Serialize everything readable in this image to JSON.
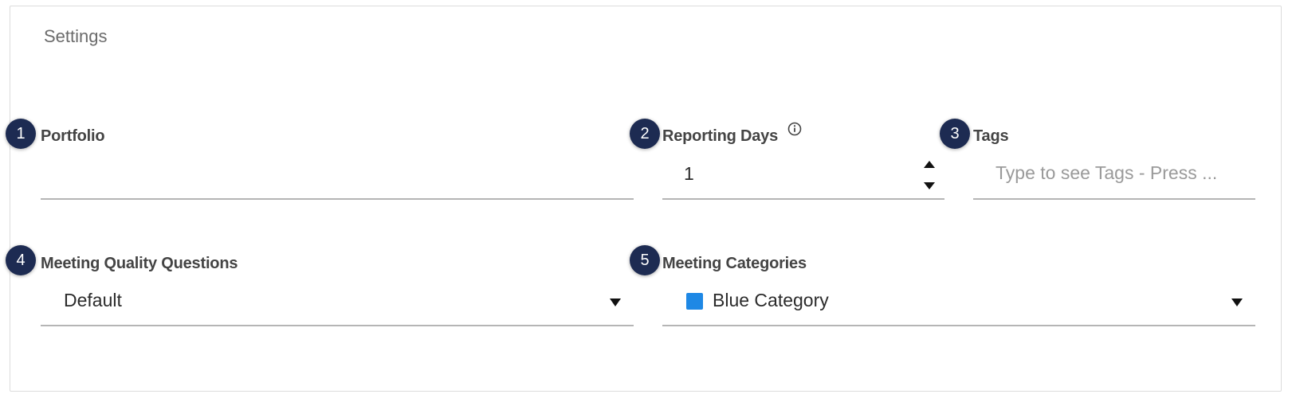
{
  "panel": {
    "title": "Settings"
  },
  "fields": {
    "portfolio": {
      "badge": "1",
      "label": "Portfolio",
      "value": ""
    },
    "reporting_days": {
      "badge": "2",
      "label": "Reporting Days",
      "value": "1",
      "info_icon": "info-circle-icon"
    },
    "tags": {
      "badge": "3",
      "label": "Tags",
      "placeholder": "Type to see Tags - Press ..."
    },
    "meeting_quality": {
      "badge": "4",
      "label": "Meeting Quality Questions",
      "selected": "Default"
    },
    "meeting_categories": {
      "badge": "5",
      "label": "Meeting Categories",
      "selected": "Blue Category",
      "swatch_color": "#1e88e5"
    }
  },
  "colors": {
    "badge": "#1d2b52",
    "underline": "#b5b5b5",
    "border": "#dcdcdc"
  }
}
